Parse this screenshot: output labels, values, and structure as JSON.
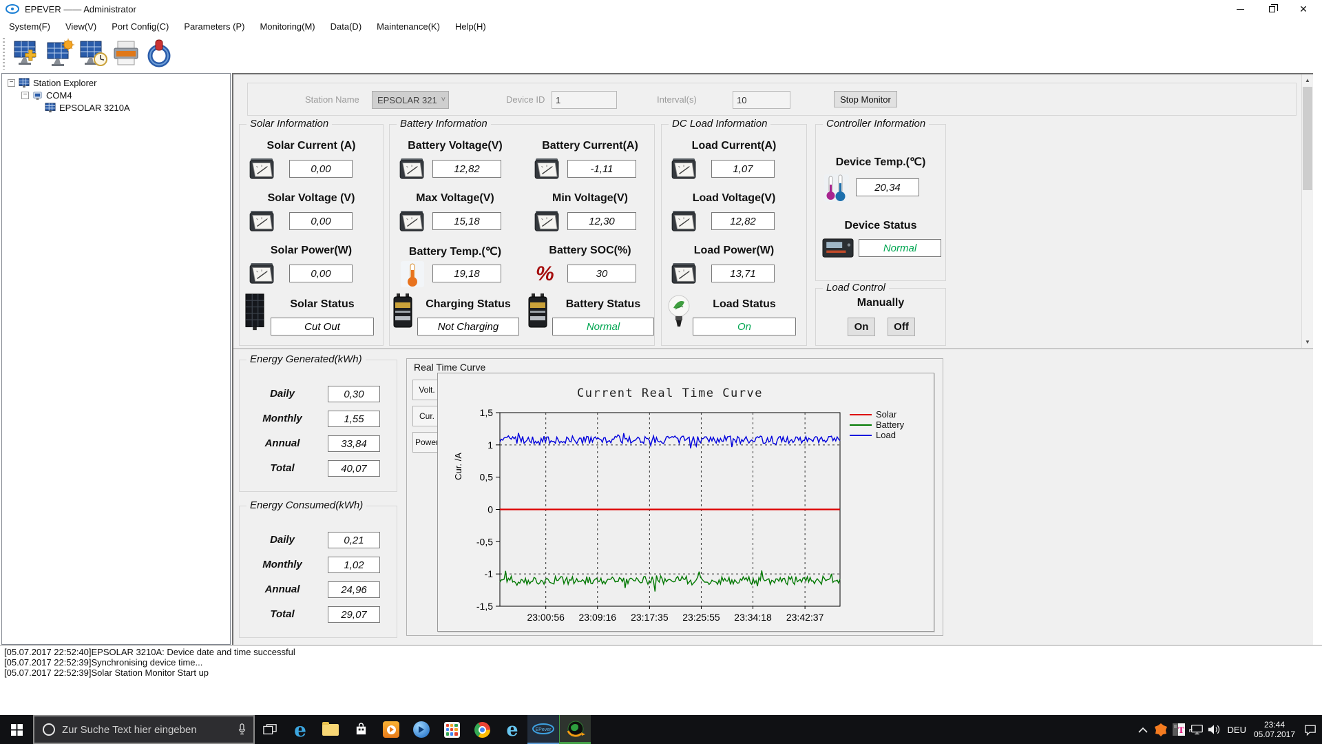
{
  "window": {
    "title": "EPEVER —— Administrator"
  },
  "menu": {
    "items": [
      "System(F)",
      "View(V)",
      "Port Config(C)",
      "Parameters (P)",
      "Monitoring(M)",
      "Data(D)",
      "Maintenance(K)",
      "Help(H)"
    ]
  },
  "toolbar": {
    "icons": [
      "add-station-icon",
      "solar-config-icon",
      "time-sync-icon",
      "print-icon",
      "power-icon"
    ]
  },
  "tree": {
    "root": "Station Explorer",
    "port": "COM4",
    "device": "EPSOLAR 3210A"
  },
  "monitor_bar": {
    "station_name_label": "Station Name",
    "station_name": "EPSOLAR 321",
    "device_id_label": "Device ID",
    "device_id": "1",
    "interval_label": "Interval(s)",
    "interval": "10",
    "stop_button": "Stop Monitor"
  },
  "solar": {
    "title": "Solar Information",
    "metrics": [
      {
        "label": "Solar Current (A)",
        "value": "0,00"
      },
      {
        "label": "Solar Voltage (V)",
        "value": "0,00"
      },
      {
        "label": "Solar Power(W)",
        "value": "0,00"
      }
    ],
    "status_label": "Solar Status",
    "status_value": "Cut Out",
    "status_color": "#000000"
  },
  "battery": {
    "title": "Battery Information",
    "metrics": [
      {
        "label": "Battery Voltage(V)",
        "value": "12,82"
      },
      {
        "label": "Battery Current(A)",
        "value": "-1,11"
      },
      {
        "label": "Max Voltage(V)",
        "value": "15,18"
      },
      {
        "label": "Min Voltage(V)",
        "value": "12,30"
      },
      {
        "label": "Battery Temp.(℃)",
        "value": "19,18"
      },
      {
        "label": "Battery SOC(%)",
        "value": "30"
      }
    ],
    "charging_status_label": "Charging Status",
    "charging_status_value": "Not Charging",
    "charging_status_color": "#000000",
    "battery_status_label": "Battery Status",
    "battery_status_value": "Normal",
    "battery_status_color": "#00a651"
  },
  "dc_load": {
    "title": "DC Load Information",
    "metrics": [
      {
        "label": "Load Current(A)",
        "value": "1,07"
      },
      {
        "label": "Load Voltage(V)",
        "value": "12,82"
      },
      {
        "label": "Load Power(W)",
        "value": "13,71"
      }
    ],
    "status_label": "Load Status",
    "status_value": "On",
    "status_color": "#00a651"
  },
  "controller": {
    "title": "Controller Information",
    "temp_label": "Device Temp.(℃)",
    "temp_value": "20,34",
    "status_label": "Device Status",
    "status_value": "Normal",
    "status_color": "#00a651"
  },
  "load_control": {
    "title": "Load Control",
    "mode_label": "Manually",
    "on_button": "On",
    "off_button": "Off"
  },
  "energy_generated": {
    "title": "Energy Generated(kWh)",
    "rows": [
      {
        "label": "Daily",
        "value": "0,30"
      },
      {
        "label": "Monthly",
        "value": "1,55"
      },
      {
        "label": "Annual",
        "value": "33,84"
      },
      {
        "label": "Total",
        "value": "40,07"
      }
    ]
  },
  "energy_consumed": {
    "title": "Energy Consumed(kWh)",
    "rows": [
      {
        "label": "Daily",
        "value": "0,21"
      },
      {
        "label": "Monthly",
        "value": "1,02"
      },
      {
        "label": "Annual",
        "value": "24,96"
      },
      {
        "label": "Total",
        "value": "29,07"
      }
    ]
  },
  "rtc": {
    "header": "Real Time Curve",
    "tabs": [
      "Volt.",
      "Cur.",
      "Power"
    ]
  },
  "chart_data": {
    "type": "line",
    "title": "Current Real Time Curve",
    "ylabel": "Cur. /A",
    "ylim": [
      -1.5,
      1.5
    ],
    "yticks": [
      {
        "v": 1.5,
        "label": "1,5"
      },
      {
        "v": 1.0,
        "label": "1"
      },
      {
        "v": 0.5,
        "label": "0,5"
      },
      {
        "v": 0.0,
        "label": "0"
      },
      {
        "v": -0.5,
        "label": "-0,5"
      },
      {
        "v": -1.0,
        "label": "-1"
      },
      {
        "v": -1.5,
        "label": "-1,5"
      }
    ],
    "xticks": [
      "23:00:56",
      "23:09:16",
      "23:17:35",
      "23:25:55",
      "23:34:18",
      "23:42:37"
    ],
    "xtick_fractions": [
      0.135,
      0.287,
      0.44,
      0.592,
      0.744,
      0.897
    ],
    "grid": "dashed",
    "legend_position": "right",
    "series": [
      {
        "name": "Solar",
        "color": "#dd0000",
        "baseline": 0.0,
        "noise": 0.0
      },
      {
        "name": "Battery",
        "color": "#007800",
        "baseline": -1.1,
        "noise": 0.065
      },
      {
        "name": "Load",
        "color": "#0000dd",
        "baseline": 1.08,
        "noise": 0.062
      }
    ],
    "points_per_series": 240,
    "seed": 12
  },
  "log": {
    "lines": [
      "[05.07.2017 22:52:40]EPSOLAR 3210A: Device date and time successful",
      "[05.07.2017 22:52:39]Synchronising device time...",
      "[05.07.2017 22:52:39]Solar Station Monitor Start up"
    ]
  },
  "taskbar": {
    "search_placeholder": "Zur Suche Text hier eingeben",
    "language": "DEU",
    "time": "23:44",
    "date": "05.07.2017"
  }
}
